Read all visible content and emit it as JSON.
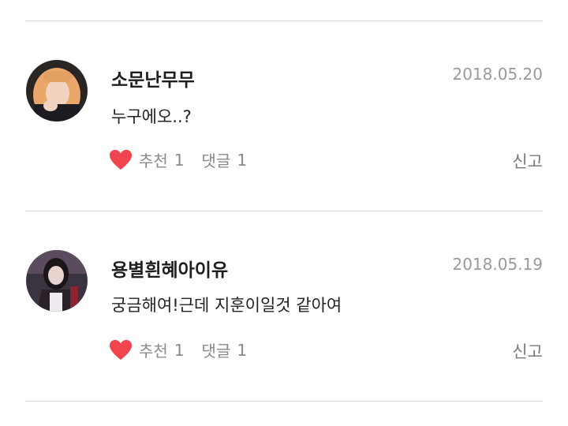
{
  "comments": [
    {
      "username": "소문난무무",
      "date": "2018.05.20",
      "text": "누구에오..?",
      "like_label": "추천",
      "like_count": "1",
      "reply_label": "댓글",
      "reply_count": "1",
      "report_label": "신고",
      "avatar_icon": "user-avatar-photo"
    },
    {
      "username": "용별흰혜아이유",
      "date": "2018.05.19",
      "text": "궁금해여!근데 지훈이일것 같아여",
      "like_label": "추천",
      "like_count": "1",
      "reply_label": "댓글",
      "reply_count": "1",
      "report_label": "신고",
      "avatar_icon": "user-avatar-photo"
    }
  ],
  "colors": {
    "heart": "#f0454f",
    "date": "#9a9a9a",
    "divider": "#dcdcdc"
  }
}
